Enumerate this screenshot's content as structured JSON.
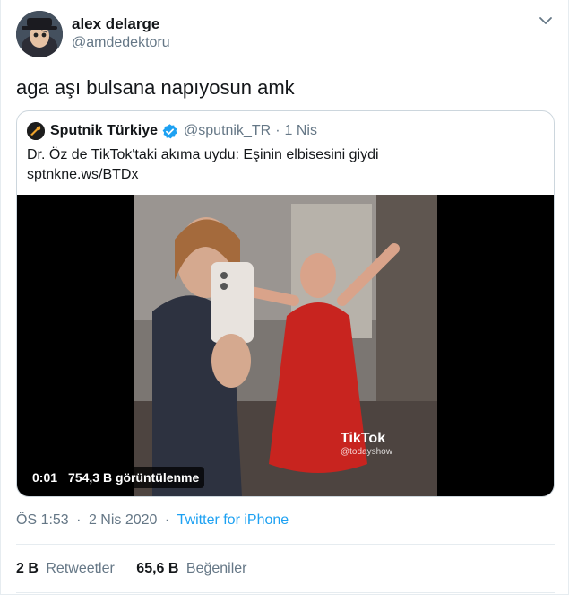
{
  "author": {
    "display_name": "alex delarge",
    "handle": "@amdedektoru"
  },
  "tweet_text": "aga aşı bulsana napıyosun amk",
  "quote": {
    "display_name": "Sputnik Türkiye",
    "handle": "@sputnik_TR",
    "separator": "·",
    "date": "1 Nis",
    "text_line1": "Dr. Öz de TikTok'taki akıma uydu: Eşinin elbisesini giydi",
    "text_line2": "sptnkne.ws/BTDx",
    "video": {
      "time": "0:01",
      "views": "754,3 B görüntülenme",
      "watermark": "TikTok",
      "watermark_sub": "@todayshow"
    }
  },
  "meta": {
    "time": "ÖS 1:53",
    "sep1": "·",
    "date": "2 Nis 2020",
    "sep2": "·",
    "source": "Twitter for iPhone"
  },
  "stats": {
    "retweets_count": "2 B",
    "retweets_label": "Retweetler",
    "likes_count": "65,6 B",
    "likes_label": "Beğeniler"
  },
  "colors": {
    "link": "#1da1f2",
    "secondary_text": "#657786",
    "border": "#ccd6dd",
    "verified": "#1da1f2"
  },
  "icons": {
    "caret": "chevron-down-icon",
    "verified": "verified-badge-icon"
  }
}
